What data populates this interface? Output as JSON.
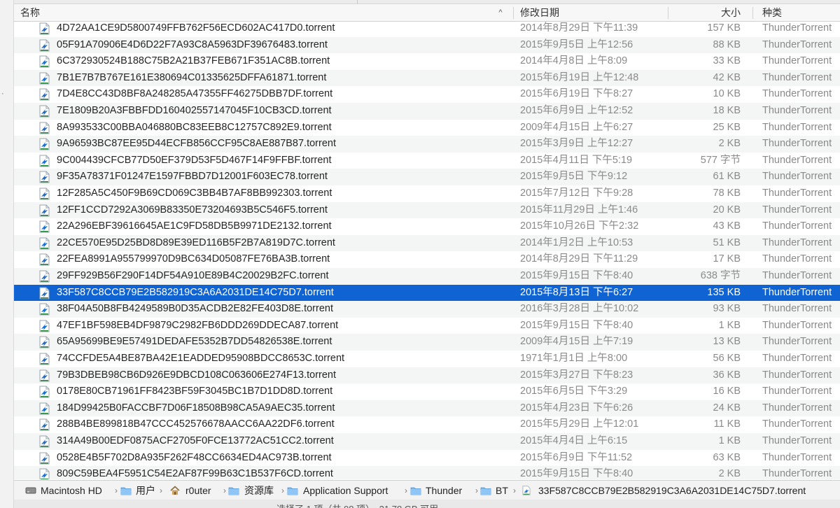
{
  "header": {
    "name": "名称",
    "sort_indicator": "^",
    "date": "修改日期",
    "size": "大小",
    "kind": "种类"
  },
  "files": [
    {
      "name": "4D72AA1CE9D5800749FFB762F56ECD602AC417D0.torrent",
      "date": "2014年8月29日 下午11:39",
      "size": "157 KB",
      "kind": "ThunderTorrent"
    },
    {
      "name": "05F91A70906E4D6D22F7A93C8A5963DF39676483.torrent",
      "date": "2015年9月5日 上午12:56",
      "size": "88 KB",
      "kind": "ThunderTorrent"
    },
    {
      "name": "6C372930524B188C75B2A21B37FEB671F351AC8B.torrent",
      "date": "2014年4月8日 上午8:09",
      "size": "33 KB",
      "kind": "ThunderTorrent"
    },
    {
      "name": "7B1E7B7B767E161E380694C01335625DFFA61871.torrent",
      "date": "2015年6月19日 上午12:48",
      "size": "42 KB",
      "kind": "ThunderTorrent"
    },
    {
      "name": "7D4E8CC43D8BF8A248285A47355FF46275DBB7DF.torrent",
      "date": "2015年6月19日 下午8:27",
      "size": "10 KB",
      "kind": "ThunderTorrent"
    },
    {
      "name": "7E1809B20A3FBBFDD160402557147045F10CB3CD.torrent",
      "date": "2015年6月9日 上午12:52",
      "size": "18 KB",
      "kind": "ThunderTorrent"
    },
    {
      "name": "8A993533C00BBA046880BC83EEB8C12757C892E9.torrent",
      "date": "2009年4月15日 上午6:27",
      "size": "25 KB",
      "kind": "ThunderTorrent"
    },
    {
      "name": "9A96593BC87EE95D44ECFB856CCF95C8AE887B87.torrent",
      "date": "2015年3月9日 上午12:27",
      "size": "2 KB",
      "kind": "ThunderTorrent"
    },
    {
      "name": "9C004439CFCB77D50EF379D53F5D467F14F9FFBF.torrent",
      "date": "2015年4月11日 下午5:19",
      "size": "577 字节",
      "kind": "ThunderTorrent"
    },
    {
      "name": "9F35A78371F01247E1597FBBD7D12001F603EC78.torrent",
      "date": "2015年9月5日 下午9:12",
      "size": "61 KB",
      "kind": "ThunderTorrent"
    },
    {
      "name": "12F285A5C450F9B69CD069C3BB4B7AF8BB992303.torrent",
      "date": "2015年7月12日 下午9:28",
      "size": "78 KB",
      "kind": "ThunderTorrent"
    },
    {
      "name": "12FF1CCD7292A3069B83350E73204693B5C546F5.torrent",
      "date": "2015年11月29日 上午1:46",
      "size": "20 KB",
      "kind": "ThunderTorrent"
    },
    {
      "name": "22A296EBF39616645AE1C9FD58DB5B9971DE2132.torrent",
      "date": "2015年10月26日 下午2:32",
      "size": "43 KB",
      "kind": "ThunderTorrent"
    },
    {
      "name": "22CE570E95D25BD8D89E39ED116B5F2B7A819D7C.torrent",
      "date": "2014年1月2日 上午10:53",
      "size": "51 KB",
      "kind": "ThunderTorrent"
    },
    {
      "name": "22FEA8991A955799970D9BC634D05087FE76BA3B.torrent",
      "date": "2014年8月29日 下午11:29",
      "size": "17 KB",
      "kind": "ThunderTorrent"
    },
    {
      "name": "29FF929B56F290F14DF54A910E89B4C20029B2FC.torrent",
      "date": "2015年9月15日 下午8:40",
      "size": "638 字节",
      "kind": "ThunderTorrent"
    },
    {
      "name": "33F587C8CCB79E2B582919C3A6A2031DE14C75D7.torrent",
      "date": "2015年8月13日 下午6:27",
      "size": "135 KB",
      "kind": "ThunderTorrent",
      "selected": true
    },
    {
      "name": "38F04A50B8FB4249589B0D35ACDB2E82FE403D8E.torrent",
      "date": "2016年3月28日 上午10:02",
      "size": "93 KB",
      "kind": "ThunderTorrent"
    },
    {
      "name": "47EF1BF598EB4DF9879C2982FB6DDD269DDECA87.torrent",
      "date": "2015年9月15日 下午8:40",
      "size": "1 KB",
      "kind": "ThunderTorrent"
    },
    {
      "name": "65A95699BE9E57491DEDAFE5352B7DD54826538E.torrent",
      "date": "2009年4月15日 上午7:19",
      "size": "13 KB",
      "kind": "ThunderTorrent"
    },
    {
      "name": "74CCFDE5A4BE87BA42E1EADDED95908BDCC8653C.torrent",
      "date": "1971年1月1日 上午8:00",
      "size": "56 KB",
      "kind": "ThunderTorrent"
    },
    {
      "name": "79B3DBEB98CB6D926E9DBCD108C063606E274F13.torrent",
      "date": "2015年3月27日 下午8:23",
      "size": "36 KB",
      "kind": "ThunderTorrent"
    },
    {
      "name": "0178E80CB71961FF8423BF59F3045BC1B7D1DD8D.torrent",
      "date": "2015年6月5日 下午3:29",
      "size": "16 KB",
      "kind": "ThunderTorrent"
    },
    {
      "name": "184D99425B0FACCBF7D06F18508B98CA5A9AEC35.torrent",
      "date": "2015年4月23日 下午6:26",
      "size": "24 KB",
      "kind": "ThunderTorrent"
    },
    {
      "name": "288B4BE899818B47CCC452576678AACC6AA22DF6.torrent",
      "date": "2015年5月29日 上午12:01",
      "size": "11 KB",
      "kind": "ThunderTorrent"
    },
    {
      "name": "314A49B00EDF0875ACF2705F0FCE13772AC51CC2.torrent",
      "date": "2015年4月4日 上午6:15",
      "size": "1 KB",
      "kind": "ThunderTorrent"
    },
    {
      "name": "0528E4B5F702D8A935F262F48CC6634ED4AC973B.torrent",
      "date": "2015年6月9日 下午11:52",
      "size": "63 KB",
      "kind": "ThunderTorrent"
    },
    {
      "name": "809C59BEA4F5951C54E2AF87F99B63C1B537F6CD.torrent",
      "date": "2015年9月15日 下午8:40",
      "size": "2 KB",
      "kind": "ThunderTorrent"
    }
  ],
  "path": [
    {
      "label": "Macintosh HD",
      "icon": "hard-drive-icon"
    },
    {
      "label": "用户",
      "icon": "folder-icon"
    },
    {
      "label": "r0uter",
      "icon": "home-icon"
    },
    {
      "label": "资源库",
      "icon": "folder-icon"
    },
    {
      "label": "Application Support",
      "icon": "folder-icon"
    },
    {
      "label": "Thunder",
      "icon": "folder-icon"
    },
    {
      "label": "BT",
      "icon": "folder-icon"
    },
    {
      "label": "33F587C8CCB79E2B582919C3A6A2031DE14C75D7.torrent",
      "icon": "torrent-file-icon"
    }
  ],
  "colors": {
    "selection": "#0f63d2",
    "folder": "#7ab8f0",
    "icon_accent": "#1a6fd1",
    "secondary_text": "#8a8a8a"
  }
}
